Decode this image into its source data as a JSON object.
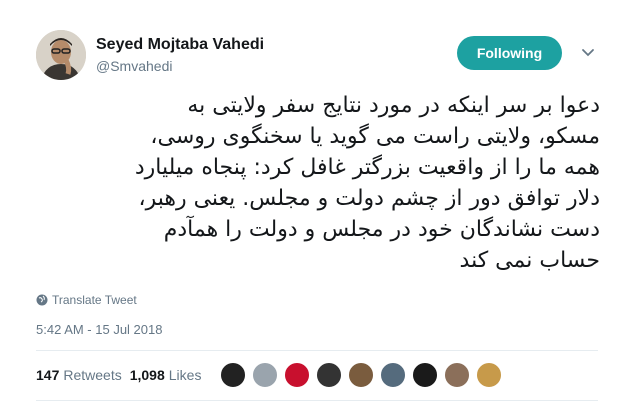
{
  "author": {
    "name": "Seyed Mojtaba Vahedi",
    "handle": "@Smvahedi"
  },
  "follow_button": {
    "label": "Following",
    "color": "#1da1a1"
  },
  "tweet": {
    "lines": [
      "دعوا بر سر اینکه در مورد نتایج سفر ولایتی به",
      "مسکو، ولایتی راست می گوید یا سخنگوی روسی،",
      "همه ما را از واقعیت بزرگتر غافل کرد: پنجاه میلیارد",
      "دلار توافق دور از چشم دولت و مجلس. یعنی رهبر،",
      "دست نشاندگان  خود در مجلس و دولت را همآدم",
      "حساب نمی کند"
    ]
  },
  "translate_label": "Translate Tweet",
  "timestamp": "5:42 AM - 15 Jul 2018",
  "stats": {
    "retweets_count": "147",
    "retweets_label": "Retweets",
    "likes_count": "1,098",
    "likes_label": "Likes"
  },
  "liker_avatar_colors": [
    "#222222",
    "#9aa4ad",
    "#c8102e",
    "#333333",
    "#7a5c3e",
    "#556b7d",
    "#1a1a1a",
    "#8b6f5a",
    "#c79a4a"
  ]
}
